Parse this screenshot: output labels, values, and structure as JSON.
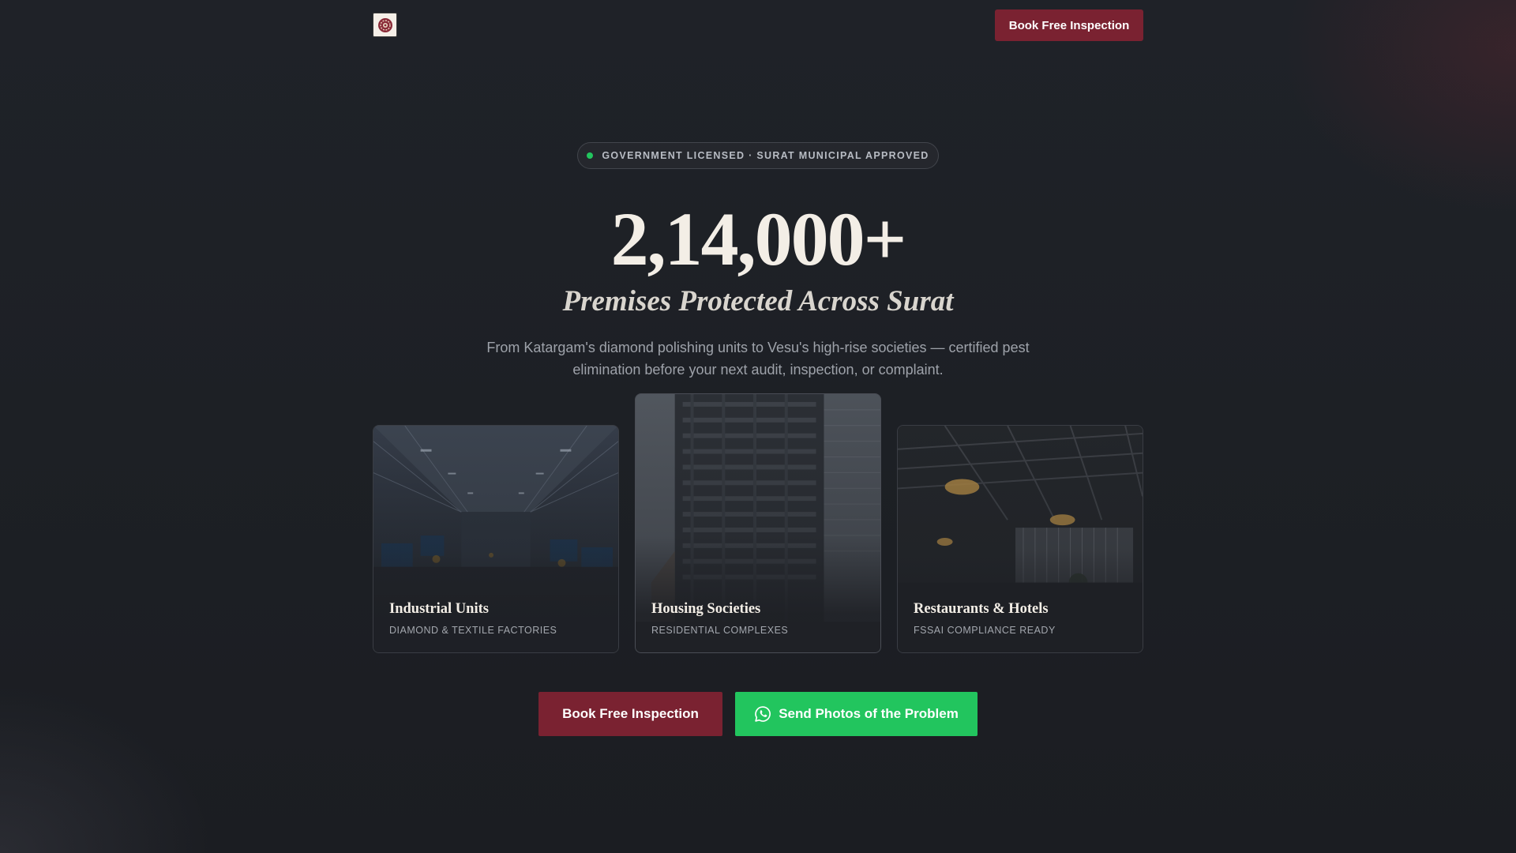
{
  "header": {
    "logo_icon": "shield-emblem-icon",
    "cta_label": "Book Free Inspection"
  },
  "badge": {
    "text": "GOVERNMENT LICENSED · SURAT MUNICIPAL APPROVED",
    "dot_color": "#22c55e"
  },
  "hero": {
    "number": "2,14,000+",
    "subtitle": "Premises Protected Across Surat",
    "description": "From Katargam's diamond polishing units to Vesu's high-rise societies — certified pest elimination before your next audit, inspection, or complaint."
  },
  "cards": [
    {
      "title": "Industrial Units",
      "tag": "DIAMOND & TEXTILE FACTORIES",
      "image": "factory-floor-photo"
    },
    {
      "title": "Housing Societies",
      "tag": "RESIDENTIAL COMPLEXES",
      "image": "high-rise-towers-photo"
    },
    {
      "title": "Restaurants & Hotels",
      "tag": "FSSAI COMPLIANCE READY",
      "image": "restaurant-interior-photo"
    }
  ],
  "cta": {
    "primary_label": "Book Free Inspection",
    "whatsapp_label": "Send Photos of the Problem",
    "whatsapp_icon": "whatsapp-icon"
  },
  "colors": {
    "brand_maroon": "#7a2231",
    "whatsapp_green": "#22c55e",
    "background": "#1f2228"
  }
}
